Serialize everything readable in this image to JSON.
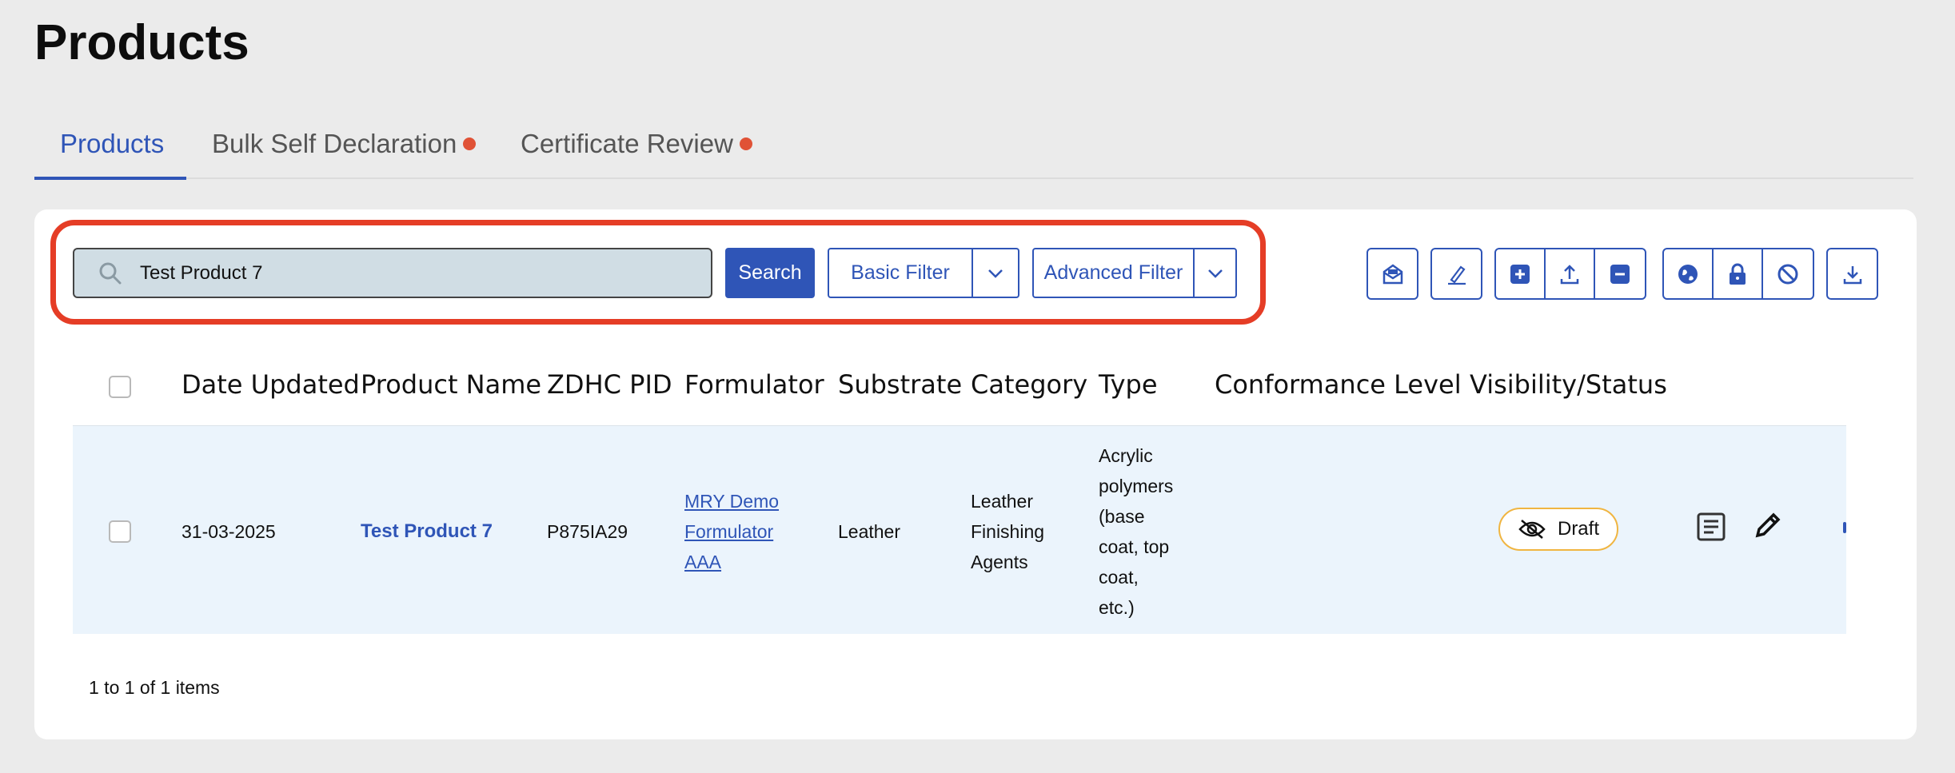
{
  "page": {
    "title": "Products"
  },
  "tabs": [
    {
      "label": "Products",
      "active": true,
      "dot": false
    },
    {
      "label": "Bulk Self Declaration",
      "active": false,
      "dot": true
    },
    {
      "label": "Certificate Review",
      "active": false,
      "dot": true
    }
  ],
  "search": {
    "value": "Test Product 7",
    "button_label": "Search"
  },
  "filters": {
    "basic_label": "Basic Filter",
    "advanced_label": "Advanced Filter"
  },
  "toolbar_icons": [
    "envelope-open-icon",
    "sign-document-icon",
    "add-icon",
    "upload-icon",
    "remove-icon",
    "globe-icon",
    "lock-icon",
    "block-icon",
    "download-icon"
  ],
  "table": {
    "columns": [
      "Date Updated",
      "Product Name",
      "ZDHC PID",
      "Formulator",
      "Substrate",
      "Category",
      "Type",
      "Conformance Level",
      "Visibility/Status"
    ],
    "rows": [
      {
        "date_updated": "31-03-2025",
        "product_name": "Test Product 7",
        "zdhc_pid": "P875IA29",
        "formulator": [
          "MRY Demo",
          "Formulator",
          "AAA"
        ],
        "substrate": "Leather",
        "category": [
          "Leather",
          "Finishing",
          "Agents"
        ],
        "type": [
          "Acrylic",
          "polymers",
          "(base",
          "coat, top",
          "coat,",
          "etc.)"
        ],
        "conformance_level": "",
        "status": "Draft"
      }
    ]
  },
  "pagination": {
    "summary": "1 to 1 of 1 items"
  },
  "colors": {
    "accent": "#2f55b7",
    "highlight": "#e53d26",
    "dot": "#e05236",
    "badge_border": "#f0b541"
  }
}
